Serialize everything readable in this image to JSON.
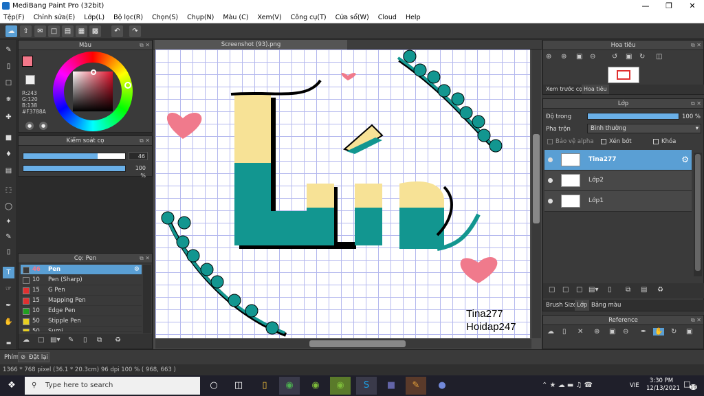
{
  "window": {
    "title": "MediBang Paint Pro (32bit)"
  },
  "menu": [
    "Tệp(F)",
    "Chỉnh sửa(E)",
    "Lớp(L)",
    "Bộ lọc(R)",
    "Chọn(S)",
    "Chụp(N)",
    "Màu (C)",
    "Xem(V)",
    "Công cụ(T)",
    "Cửa sổ(W)",
    "Cloud",
    "Help"
  ],
  "color_panel": {
    "title": "Màu",
    "r": "R:243",
    "g": "G:120",
    "b": "B:138",
    "hex": "#F3788A",
    "fg_color": "#f3788a"
  },
  "brush_control": {
    "title": "Kiểm soát cọ",
    "size_value": "46",
    "opacity_value": "100 %",
    "size_fraction": 0.8,
    "opacity_fraction": 1.0
  },
  "brush_panel": {
    "title": "Cọ: Pen",
    "brushes": [
      {
        "size": "46",
        "name": "Pen",
        "color": "#3a3a3a"
      },
      {
        "size": "10",
        "name": "Pen (Sharp)",
        "color": "#3a3a3a"
      },
      {
        "size": "15",
        "name": "G Pen",
        "color": "#e03030"
      },
      {
        "size": "15",
        "name": "Mapping Pen",
        "color": "#e03030"
      },
      {
        "size": "10",
        "name": "Edge Pen",
        "color": "#20a020"
      },
      {
        "size": "50",
        "name": "Stipple Pen",
        "color": "#e8d020"
      },
      {
        "size": "50",
        "name": "Sumi",
        "color": "#e8d020"
      }
    ]
  },
  "canvas": {
    "tab": "Screenshot (93).png",
    "art_title": "Lúc",
    "watermark_line1": "Tina277",
    "watermark_line2": "Hoidap247"
  },
  "navigator": {
    "title": "Hoa tiêu",
    "tab1": "Xem trước cọ",
    "tab2": "Hoa tiêu"
  },
  "layer_panel": {
    "title": "Lớp",
    "opacity_label": "Độ trong",
    "opacity_value": "100 %",
    "blend_label": "Pha trộn",
    "blend_value": "Bình thường",
    "protect_alpha": "Bảo vệ alpha",
    "clipping": "Xén bớt",
    "lock": "Khóa",
    "layers": [
      "Tina277",
      "Lớp2",
      "Lớp1"
    ],
    "tabs": [
      "Brush Size",
      "Lớp",
      "Bảng màu"
    ]
  },
  "reference": {
    "title": "Reference"
  },
  "status": {
    "tab": "Phím",
    "reset": "Đặt lại",
    "info": "1366 * 768 pixel   (36.1 * 20.3cm)   96 dpi   100 %   ( 968, 663 )"
  },
  "taskbar": {
    "search_placeholder": "Type here to search",
    "lang": "VIE",
    "time": "3:30 PM",
    "date": "12/13/2021",
    "notif": "10"
  }
}
